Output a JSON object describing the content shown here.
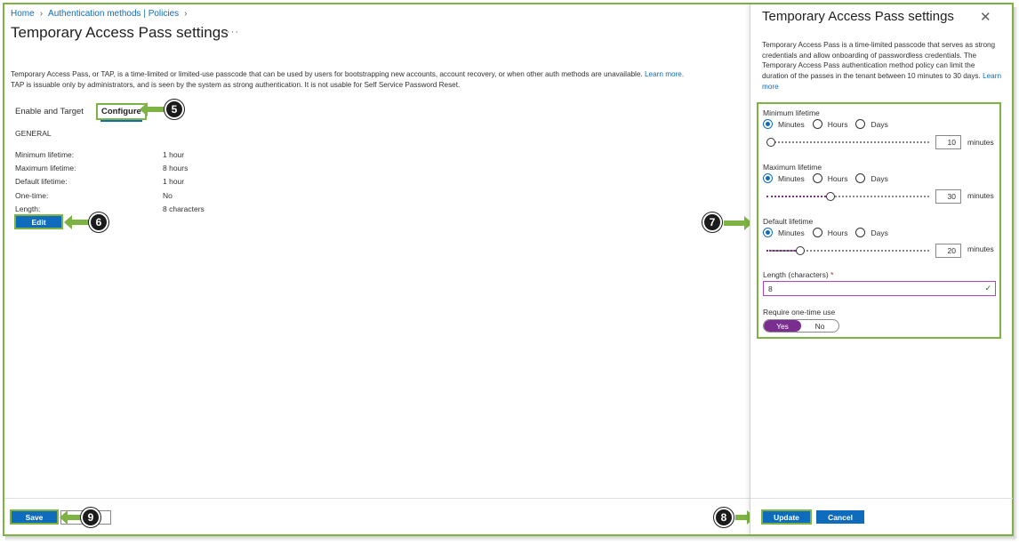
{
  "breadcrumb": {
    "home": "Home",
    "section": "Authentication methods | Policies"
  },
  "page": {
    "title": "Temporary Access Pass settings",
    "more": "···",
    "description_1": "Temporary Access Pass, or TAP, is a time-limited or limited-use passcode that can be used by users for bootstrapping new accounts, account recovery, or when other auth methods are unavailable.",
    "learn_more": "Learn more.",
    "description_2": "TAP is issuable only by administrators, and is seen by the system as strong authentication. It is not usable for Self Service Password Reset."
  },
  "tabs": {
    "enable_target": "Enable and Target",
    "configure": "Configure"
  },
  "general": {
    "heading": "GENERAL",
    "rows": [
      {
        "label": "Minimum lifetime:",
        "value": "1 hour"
      },
      {
        "label": "Maximum lifetime:",
        "value": "8 hours"
      },
      {
        "label": "Default lifetime:",
        "value": "1 hour"
      },
      {
        "label": "One-time:",
        "value": "No"
      },
      {
        "label": "Length:",
        "value": "8 characters"
      }
    ],
    "edit_label": "Edit"
  },
  "footer": {
    "save_label": "Save",
    "discard_label": ""
  },
  "callouts": {
    "c5": "5",
    "c6": "6",
    "c7": "7",
    "c8": "8",
    "c9": "9"
  },
  "panel": {
    "title": "Temporary Access Pass settings",
    "close": "✕",
    "description": "Temporary Access Pass is a time-limited passcode that serves as strong credentials and allow onboarding of passwordless credentials. The Temporary Access Pass authentication method policy can limit the duration of the passes in the tenant between 10 minutes to 30 days.",
    "learn_more": "Learn more",
    "radio_options": [
      "Minutes",
      "Hours",
      "Days"
    ],
    "unit": "minutes",
    "minimum": {
      "label": "Minimum lifetime",
      "selected": "Minutes",
      "value": "10",
      "slider_fraction": 0.0
    },
    "maximum": {
      "label": "Maximum lifetime",
      "selected": "Minutes",
      "value": "30",
      "slider_fraction": 0.39
    },
    "default": {
      "label": "Default lifetime",
      "selected": "Minutes",
      "value": "20",
      "slider_fraction": 0.19
    },
    "length": {
      "label": "Length (characters)",
      "required": "*",
      "value": "8"
    },
    "one_time": {
      "label": "Require one-time use",
      "yes": "Yes",
      "no": "No",
      "selected": "Yes"
    },
    "update_label": "Update",
    "cancel_label": "Cancel"
  },
  "colors": {
    "accent": "#0f6cbd",
    "highlight": "#7cb342",
    "slider": "#7a2e8f"
  }
}
